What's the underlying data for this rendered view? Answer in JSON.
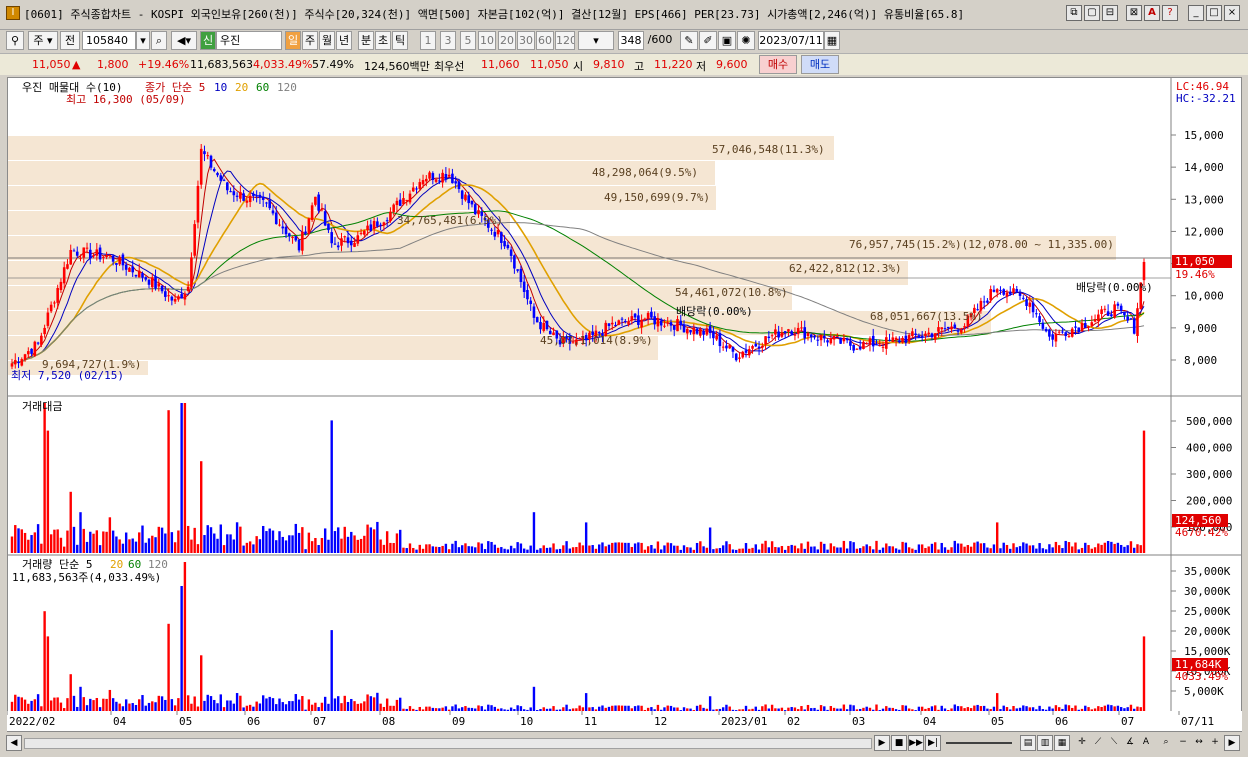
{
  "window": {
    "app_icon": "I",
    "title": "[0601] 주식종합차트 - KOSPI 외국인보유[260(천)] 주식수[20,324(천)] 액면[500] 자본금[102(억)] 결산[12월] EPS[466] PER[23.73] 시가총액[2,246(억)] 유통비율[65.8]",
    "buttons": [
      "⧉",
      "▢",
      "⊟",
      "⊠",
      "A",
      "?",
      "_",
      "□",
      "×"
    ]
  },
  "toolbar": {
    "market": "주",
    "prev_label": "전",
    "code": "105840",
    "stock_badge": "신",
    "stock_name": "우진",
    "periods": [
      "일",
      "주",
      "월",
      "년",
      "분",
      "초",
      "틱"
    ],
    "minutes": [
      "1",
      "3",
      "5",
      "10",
      "20",
      "30",
      "60",
      "120"
    ],
    "count": "348",
    "count_total": "/600",
    "date": "2023/07/11"
  },
  "quote": {
    "price": "11,050",
    "arrow": "▲",
    "change": "1,800",
    "change_pct": "+19.46%",
    "volume": "11,683,563",
    "volume_pct": "4,033.49%",
    "turnover": "57.49%",
    "amount": "124,560백만",
    "best_label": "최우선",
    "best_ask": "11,060",
    "best_bid": "11,050",
    "open_label": "시",
    "open": "9,810",
    "high_label": "고",
    "high": "11,220",
    "low_label": "저",
    "low": "9,600",
    "buy_button": "매수",
    "sell_button": "매도"
  },
  "price_pane": {
    "title": "우진 매물대 수(10)",
    "legend": [
      "종가 단순 5",
      "10",
      "20",
      "60",
      "120"
    ],
    "legend_colors": [
      "#c00000",
      "#0000c0",
      "#e0a000",
      "#008000",
      "#808080"
    ],
    "high_marker": "최고 16,300 (05/09)",
    "low_marker": "최저 7,520 (02/15)",
    "lc": "LC:46.94",
    "hc": "HC:-32.21",
    "last_price": "11,050",
    "last_pct": "19.46%",
    "y_labels": [
      "15,000",
      "14,000",
      "13,000",
      "12,000",
      "11,000",
      "10,000",
      "9,000",
      "8,000"
    ],
    "volume_profile": [
      "57,046,548(11.3%)",
      "48,298,064(9.5%)",
      "49,150,699(9.7%)",
      "34,765,481(6.9%)",
      "76,957,745(15.2%)(12,078.00 ~ 11,335.00)",
      "62,422,812(12.3%)",
      "54,461,072(10.8%)",
      "68,051,667(13.5%)",
      "45,07,1,014(8.9%)",
      "9,694,727(1.9%)"
    ],
    "annotations": [
      "배당락(0.00%)",
      "배당락(0.00%)"
    ]
  },
  "amount_pane": {
    "title": "거래대금",
    "y_labels": [
      "500,000",
      "400,000",
      "300,000",
      "200,000",
      "100,000"
    ],
    "last_value": "124,560",
    "last_pct": "4670.42%"
  },
  "volume_pane": {
    "title": "거래량 단순 5",
    "legend": [
      "20",
      "60",
      "120"
    ],
    "subtitle": "11,683,563주(4,033.49%)",
    "y_labels": [
      "35,000K",
      "30,000K",
      "25,000K",
      "20,000K",
      "15,000K",
      "10,000K",
      "5,000K"
    ],
    "last_value": "11,684K",
    "last_pct": "4033.49%"
  },
  "x_axis": [
    "2022/02",
    "04",
    "05",
    "06",
    "07",
    "08",
    "09",
    "10",
    "11",
    "12",
    "2023/01",
    "02",
    "03",
    "04",
    "05",
    "06",
    "07",
    "07/11"
  ],
  "colors": {
    "up": "#ff0000",
    "down": "#0000ff",
    "profile": "#f5e6d3",
    "ma5": "#c00000",
    "ma10": "#0000c0",
    "ma20": "#e0a000",
    "ma60": "#008000",
    "ma120": "#808080"
  }
}
